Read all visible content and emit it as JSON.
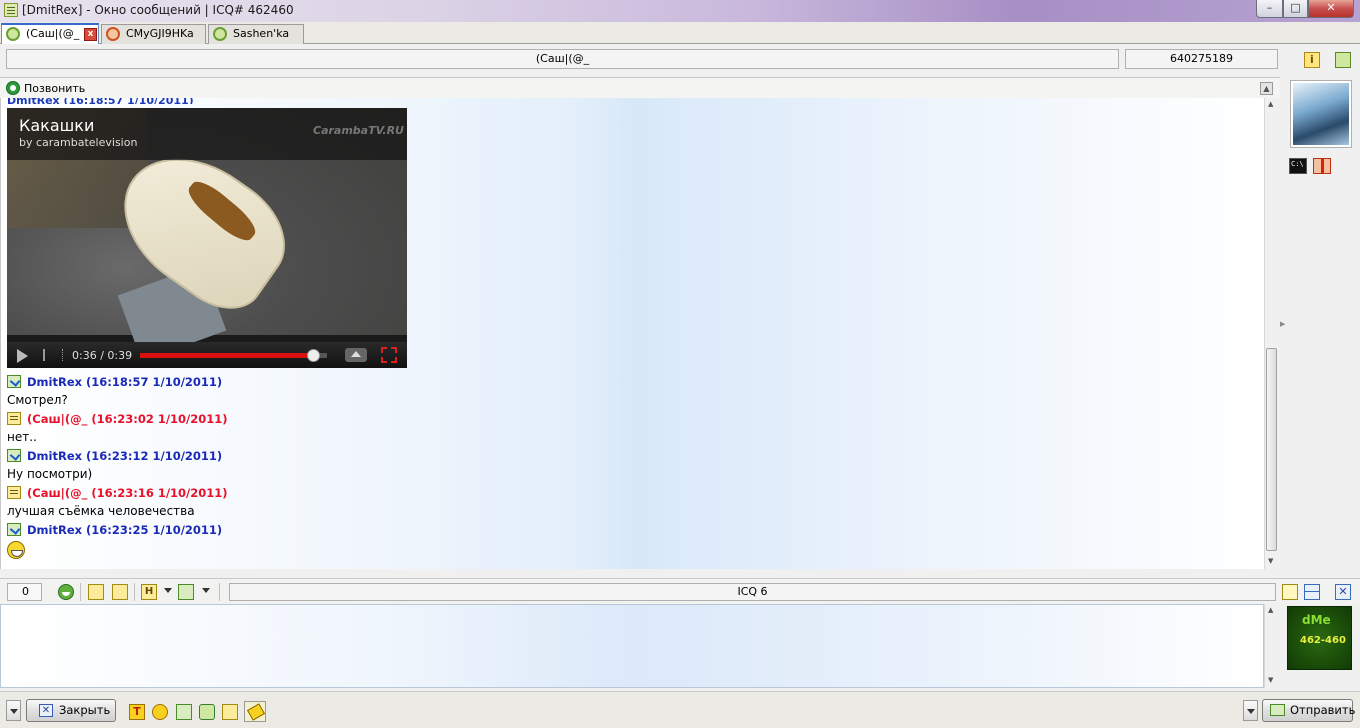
{
  "window": {
    "title": "[DmitRex] - Окно сообщений | ICQ# 462460",
    "min_glyph": "–",
    "max_glyph": "□",
    "close_glyph": "✕"
  },
  "tabs": [
    {
      "label": "(Саш|(@_",
      "active": true,
      "icon": "flower-green-icon"
    },
    {
      "label": "СMyGJI9HKa",
      "active": false,
      "icon": "flower-red-icon"
    },
    {
      "label": "Sashen'ka",
      "active": false,
      "icon": "flower-green-icon"
    }
  ],
  "header": {
    "contact_name": "(Саш|(@_",
    "contact_uin": "640275189"
  },
  "call_bar": {
    "label": "Позвонить",
    "collapse_glyph": "▲"
  },
  "video": {
    "title": "Какашки",
    "subtitle": "by carambatelevision",
    "logo": "CarambaTV.RU",
    "time": "0:36 / 0:39",
    "progress": 0.923
  },
  "messages": [
    {
      "sender": "me",
      "header": "DmitRex (16:18:57 1/10/2011)",
      "text": "Смотрел?"
    },
    {
      "sender": "them",
      "header": "(Саш|(@_ (16:23:02 1/10/2011)",
      "text": "нет.."
    },
    {
      "sender": "me",
      "header": "DmitRex (16:23:12 1/10/2011)",
      "text": "Ну посмотри)"
    },
    {
      "sender": "them",
      "header": "(Саш|(@_ (16:23:16 1/10/2011)",
      "text": "лучшая съёмка человечества"
    },
    {
      "sender": "me",
      "header": "DmitRex (16:23:25 1/10/2011)",
      "text": ""
    }
  ],
  "toolbar": {
    "char_count": "0",
    "status_text": "ICQ 6",
    "history_glyph": "H",
    "close_glyph": "✕"
  },
  "my_avatar": {
    "logo": "dMe",
    "number": "462-460"
  },
  "bottom": {
    "close_label": "Закрыть",
    "close_glyph": "✕",
    "send_label": "Отправить",
    "format_glyph": "T"
  },
  "colors": {
    "my_name": "#1a2ab8",
    "their_name": "#e8102a",
    "progress": "#d81010"
  }
}
